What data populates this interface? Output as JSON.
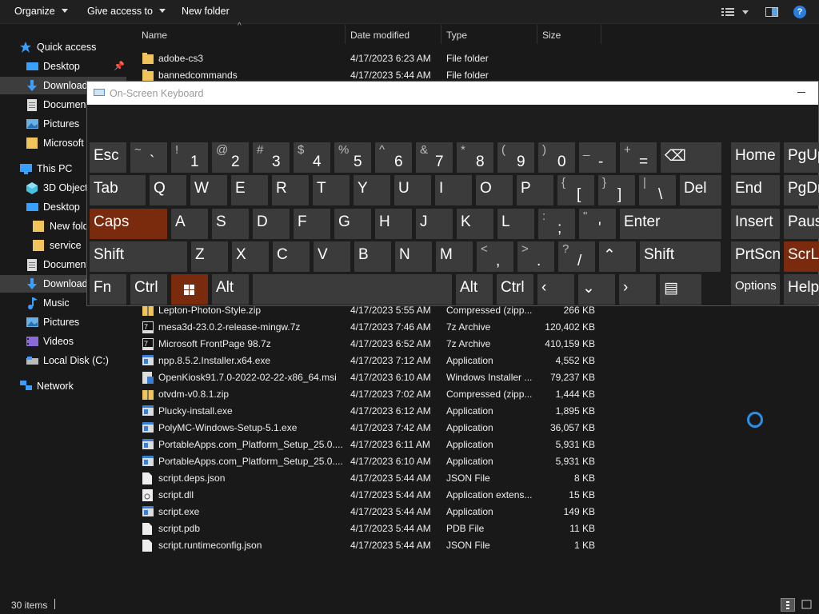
{
  "toolbar": {
    "organize": "Organize",
    "give_access": "Give access to",
    "new_folder": "New folder"
  },
  "nav": {
    "quick_access": "Quick access",
    "desktop": "Desktop",
    "downloads": "Download",
    "documents": "Document",
    "pictures": "Pictures",
    "microsoft": "Microsoft",
    "this_pc": "This PC",
    "objects3d": "3D Objects",
    "desktop2": "Desktop",
    "new_folder": "New fold",
    "service": "service",
    "documents2": "Document",
    "downloads2": "Download",
    "music": "Music",
    "pictures2": "Pictures",
    "videos": "Videos",
    "local_disk": "Local Disk (C:)",
    "network": "Network"
  },
  "columns": {
    "name": "Name",
    "date": "Date modified",
    "type": "Type",
    "size": "Size"
  },
  "files_top": [
    {
      "name": "adobe-cs3",
      "date": "4/17/2023 6:23 AM",
      "type": "File folder",
      "size": ""
    },
    {
      "name": "bannedcommands",
      "date": "4/17/2023 5:44 AM",
      "type": "File folder",
      "size": ""
    }
  ],
  "files": [
    {
      "name": "Lepton-Photon-Style.zip",
      "date": "4/17/2023 5:55 AM",
      "type": "Compressed (zipp...",
      "size": "266 KB",
      "icon": "zip"
    },
    {
      "name": "mesa3d-23.0.2-release-mingw.7z",
      "date": "4/17/2023 7:46 AM",
      "type": "7z Archive",
      "size": "120,402 KB",
      "icon": "7z"
    },
    {
      "name": "Microsoft FrontPage 98.7z",
      "date": "4/17/2023 6:52 AM",
      "type": "7z Archive",
      "size": "410,159 KB",
      "icon": "7z"
    },
    {
      "name": "npp.8.5.2.Installer.x64.exe",
      "date": "4/17/2023 7:12 AM",
      "type": "Application",
      "size": "4,552 KB",
      "icon": "app"
    },
    {
      "name": "OpenKiosk91.7.0-2022-02-22-x86_64.msi",
      "date": "4/17/2023 6:10 AM",
      "type": "Windows Installer ...",
      "size": "79,237 KB",
      "icon": "msi"
    },
    {
      "name": "otvdm-v0.8.1.zip",
      "date": "4/17/2023 7:02 AM",
      "type": "Compressed (zipp...",
      "size": "1,444 KB",
      "icon": "zip"
    },
    {
      "name": "Plucky-install.exe",
      "date": "4/17/2023 6:12 AM",
      "type": "Application",
      "size": "1,895 KB",
      "icon": "app"
    },
    {
      "name": "PolyMC-Windows-Setup-5.1.exe",
      "date": "4/17/2023 7:42 AM",
      "type": "Application",
      "size": "36,057 KB",
      "icon": "app"
    },
    {
      "name": "PortableApps.com_Platform_Setup_25.0....",
      "date": "4/17/2023 6:11 AM",
      "type": "Application",
      "size": "5,931 KB",
      "icon": "app"
    },
    {
      "name": "PortableApps.com_Platform_Setup_25.0....",
      "date": "4/17/2023 6:10 AM",
      "type": "Application",
      "size": "5,931 KB",
      "icon": "app"
    },
    {
      "name": "script.deps.json",
      "date": "4/17/2023 5:44 AM",
      "type": "JSON File",
      "size": "8 KB",
      "icon": "doc"
    },
    {
      "name": "script.dll",
      "date": "4/17/2023 5:44 AM",
      "type": "Application extens...",
      "size": "15 KB",
      "icon": "dll"
    },
    {
      "name": "script.exe",
      "date": "4/17/2023 5:44 AM",
      "type": "Application",
      "size": "149 KB",
      "icon": "app"
    },
    {
      "name": "script.pdb",
      "date": "4/17/2023 5:44 AM",
      "type": "PDB File",
      "size": "11 KB",
      "icon": "doc"
    },
    {
      "name": "script.runtimeconfig.json",
      "date": "4/17/2023 5:44 AM",
      "type": "JSON File",
      "size": "1 KB",
      "icon": "doc"
    }
  ],
  "status": {
    "items": "30 items"
  },
  "osk": {
    "title": "On-Screen Keyboard",
    "rows": [
      [
        {
          "m": "Esc",
          "w": 46
        },
        {
          "s": "~",
          "b": "`",
          "w": 46
        },
        {
          "s": "!",
          "b": "1",
          "w": 46
        },
        {
          "s": "@",
          "b": "2",
          "w": 46
        },
        {
          "s": "#",
          "b": "3",
          "w": 46
        },
        {
          "s": "$",
          "b": "4",
          "w": 46
        },
        {
          "s": "%",
          "b": "5",
          "w": 46
        },
        {
          "s": "^",
          "b": "6",
          "w": 46
        },
        {
          "s": "&",
          "b": "7",
          "w": 46
        },
        {
          "s": "*",
          "b": "8",
          "w": 46
        },
        {
          "s": "(",
          "b": "9",
          "w": 46
        },
        {
          "s": ")",
          "b": "0",
          "w": 46
        },
        {
          "s": "_",
          "b": "-",
          "w": 46
        },
        {
          "s": "+",
          "b": "=",
          "w": 46
        },
        {
          "m": "⌫",
          "w": 76
        }
      ],
      [
        {
          "m": "Tab",
          "w": 70
        },
        {
          "m": "Q",
          "w": 46
        },
        {
          "m": "W",
          "w": 46
        },
        {
          "m": "E",
          "w": 46
        },
        {
          "m": "R",
          "w": 46
        },
        {
          "m": "T",
          "w": 46
        },
        {
          "m": "Y",
          "w": 46
        },
        {
          "m": "U",
          "w": 46
        },
        {
          "m": "I",
          "w": 46
        },
        {
          "m": "O",
          "w": 46
        },
        {
          "m": "P",
          "w": 46
        },
        {
          "s": "{",
          "b": "[",
          "w": 46
        },
        {
          "s": "}",
          "b": "]",
          "w": 46
        },
        {
          "s": "|",
          "b": "\\",
          "w": 46
        },
        {
          "m": "Del",
          "w": 52
        }
      ],
      [
        {
          "m": "Caps",
          "w": 97,
          "acc": true
        },
        {
          "m": "A",
          "w": 46
        },
        {
          "m": "S",
          "w": 46
        },
        {
          "m": "D",
          "w": 46
        },
        {
          "m": "F",
          "w": 46
        },
        {
          "m": "G",
          "w": 46
        },
        {
          "m": "H",
          "w": 46
        },
        {
          "m": "J",
          "w": 46
        },
        {
          "m": "K",
          "w": 46
        },
        {
          "m": "L",
          "w": 46
        },
        {
          "s": ":",
          "b": ";",
          "w": 46
        },
        {
          "s": "\"",
          "b": "'",
          "w": 46
        },
        {
          "m": "Enter",
          "w": 127
        }
      ],
      [
        {
          "m": "Shift",
          "w": 122
        },
        {
          "m": "Z",
          "w": 46
        },
        {
          "m": "X",
          "w": 46
        },
        {
          "m": "C",
          "w": 46
        },
        {
          "m": "V",
          "w": 46
        },
        {
          "m": "B",
          "w": 46
        },
        {
          "m": "N",
          "w": 46
        },
        {
          "m": "M",
          "w": 46
        },
        {
          "s": "<",
          "b": ",",
          "w": 46
        },
        {
          "s": ">",
          "b": ".",
          "w": 46
        },
        {
          "s": "?",
          "b": "/",
          "w": 46
        },
        {
          "m": "⌃",
          "w": 46
        },
        {
          "m": "Shift",
          "w": 101
        }
      ],
      [
        {
          "m": "Fn",
          "w": 46
        },
        {
          "m": "Ctrl",
          "w": 46
        },
        {
          "m": "win",
          "w": 46,
          "acc": true
        },
        {
          "m": "Alt",
          "w": 46
        },
        {
          "m": "",
          "w": 249
        },
        {
          "m": "Alt",
          "w": 46
        },
        {
          "m": "Ctrl",
          "w": 46
        },
        {
          "m": "‹",
          "w": 46
        },
        {
          "m": "⌄",
          "w": 46
        },
        {
          "m": "›",
          "w": 46
        },
        {
          "m": "▤",
          "w": 52
        }
      ]
    ],
    "nav_keys": [
      [
        {
          "m": "Home"
        },
        {
          "m": "PgUp"
        }
      ],
      [
        {
          "m": "End"
        },
        {
          "m": "PgDn"
        }
      ],
      [
        {
          "m": "Insert"
        },
        {
          "m": "Pause"
        }
      ],
      [
        {
          "m": "PrtScn"
        },
        {
          "m": "ScrLk",
          "acc": true
        }
      ],
      [
        {
          "m": "Options",
          "sm": true
        },
        {
          "m": "Help"
        }
      ]
    ]
  }
}
